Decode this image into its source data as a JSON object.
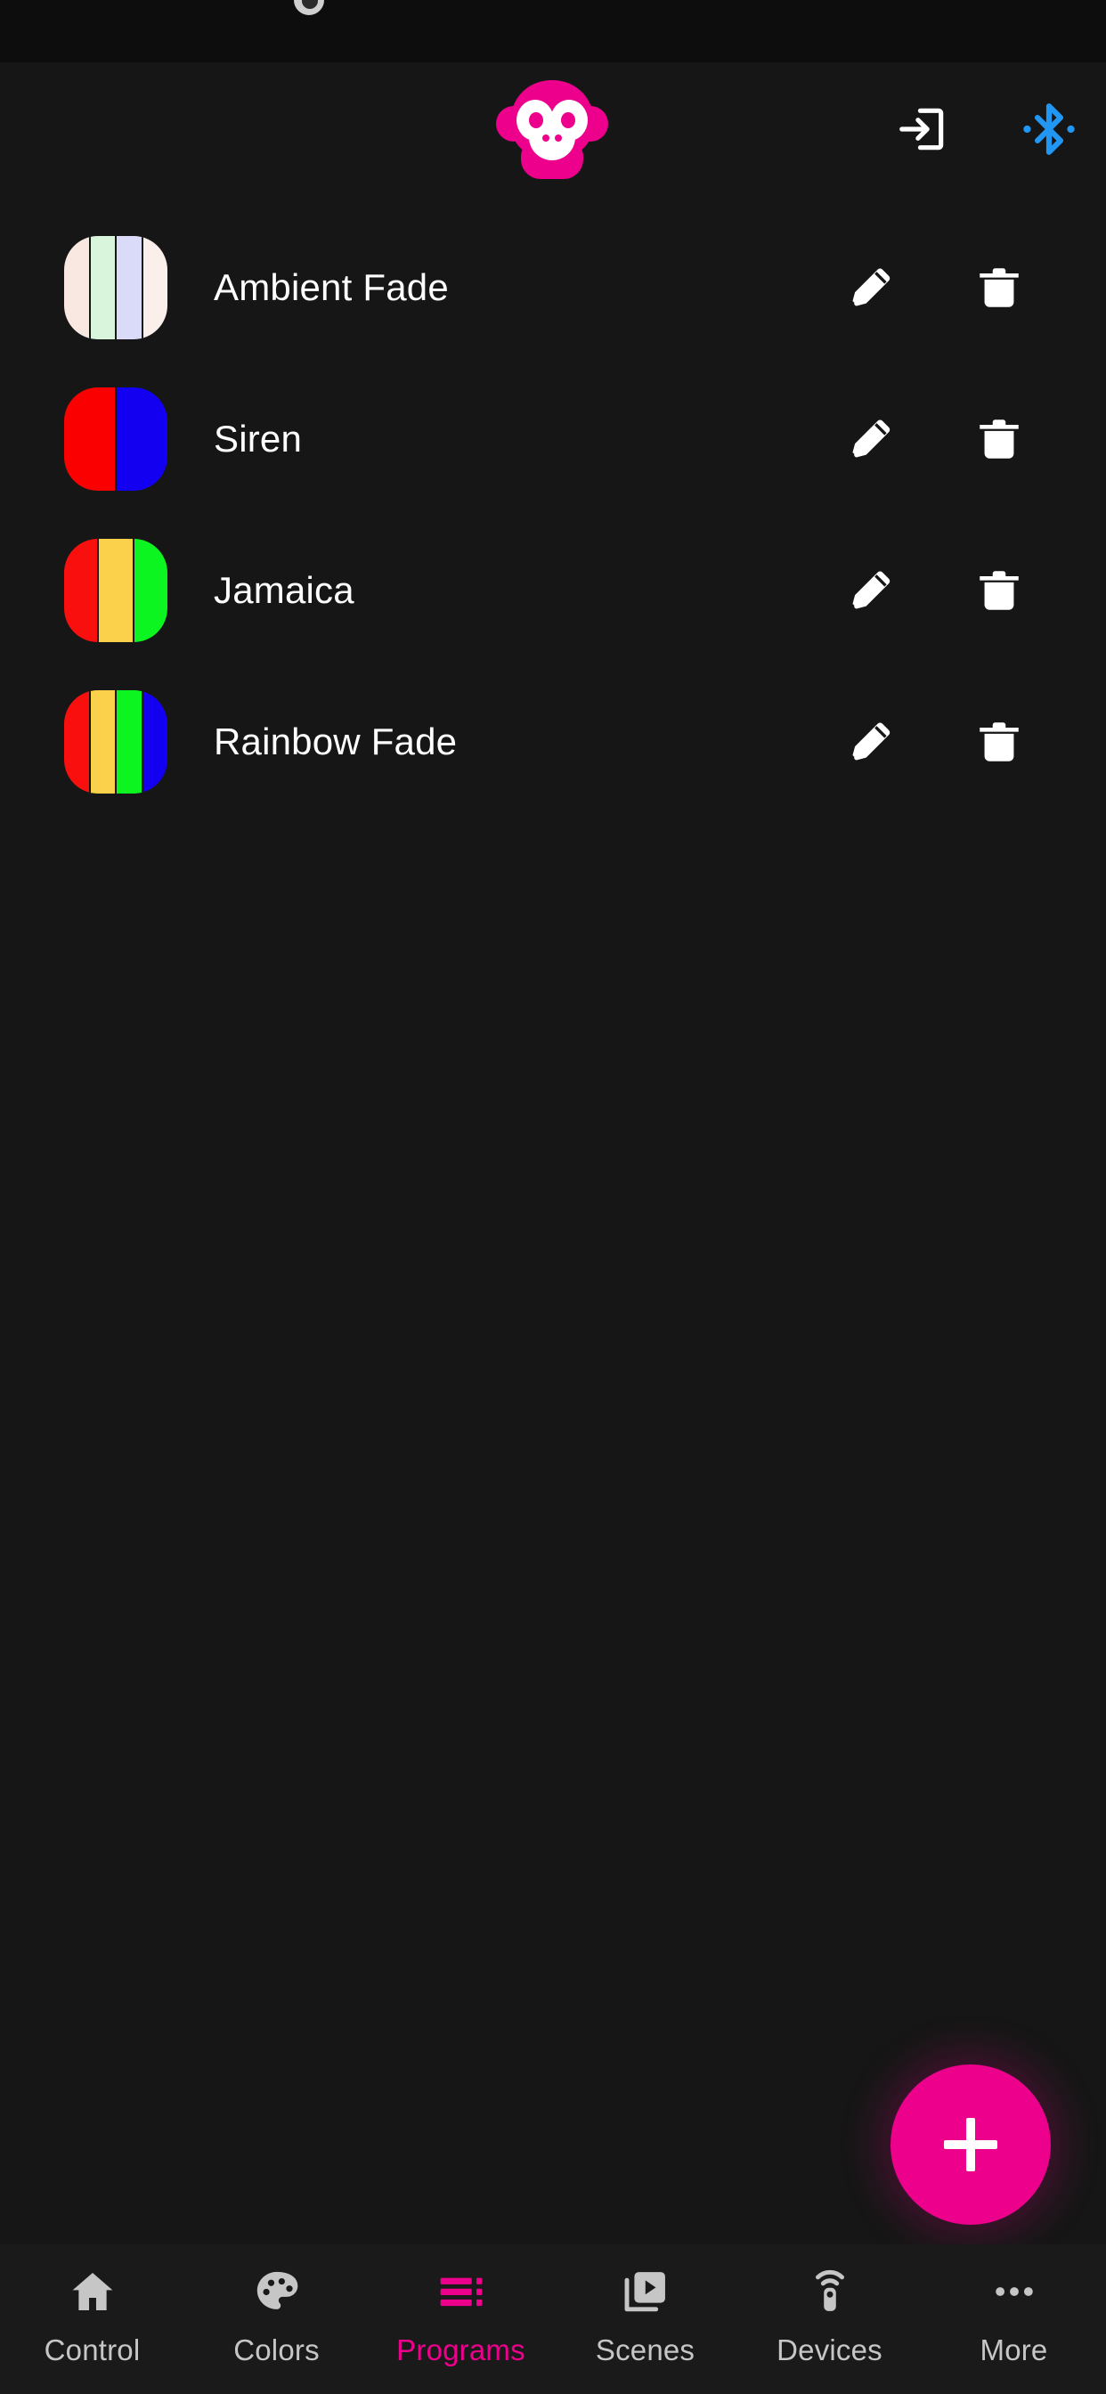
{
  "theme": {
    "background": "#161616",
    "statusbar_background": "#0d0d0d",
    "navbar_background": "#1a1a1a",
    "accent_pink": "#ec008c",
    "bluetooth_blue": "#2196f3",
    "icon_white": "#ffffff",
    "nav_inactive": "#c6c6c6"
  },
  "appbar": {
    "logo_name": "monkey-logo",
    "logo_color": "#ec008c",
    "actions": [
      {
        "name": "login-icon",
        "label": "Login"
      },
      {
        "name": "bluetooth-icon",
        "label": "Bluetooth"
      }
    ]
  },
  "programs": [
    {
      "name": "Ambient Fade",
      "colors": [
        "#f9e8e1",
        "#d9f6dc",
        "#dadaf9",
        "#fbefeb"
      ],
      "edit_label": "Edit",
      "delete_label": "Delete"
    },
    {
      "name": "Siren",
      "colors": [
        "#fa0000",
        "#1400f0"
      ],
      "edit_label": "Edit",
      "delete_label": "Delete"
    },
    {
      "name": "Jamaica",
      "colors": [
        "#fa0f0f",
        "#fbd04b",
        "#0cf520"
      ],
      "edit_label": "Edit",
      "delete_label": "Delete"
    },
    {
      "name": "Rainbow Fade",
      "colors": [
        "#fa0f0f",
        "#fbd04b",
        "#0cf520",
        "#1400f0"
      ],
      "edit_label": "Edit",
      "delete_label": "Delete"
    }
  ],
  "fab": {
    "label": "+",
    "name": "add-program-button",
    "color": "#ec008c"
  },
  "bottom_nav": {
    "active_index": 2,
    "items": [
      {
        "label": "Control",
        "icon": "home-icon"
      },
      {
        "label": "Colors",
        "icon": "palette-icon"
      },
      {
        "label": "Programs",
        "icon": "list-queue-icon"
      },
      {
        "label": "Scenes",
        "icon": "video-library-icon"
      },
      {
        "label": "Devices",
        "icon": "remote-control-icon"
      },
      {
        "label": "More",
        "icon": "more-horizontal-icon"
      }
    ]
  }
}
